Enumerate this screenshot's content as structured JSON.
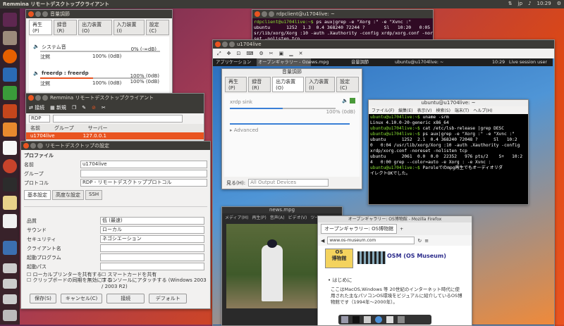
{
  "topbar": {
    "title": "Remmina リモートデスクトップクライアント",
    "kbd": "jp",
    "time": "10:29"
  },
  "launcher": {
    "icons": [
      "dash-icon",
      "files-icon",
      "firefox-icon",
      "writer-icon",
      "calc-icon",
      "impress-icon",
      "software-center-icon",
      "amazon-icon",
      "settings-icon",
      "terminal-icon",
      "text-editor-icon",
      "remmina-icon",
      "drive-icon",
      "drive-icon-2",
      "drive-icon-3",
      "trash-icon"
    ]
  },
  "volume_win": {
    "title": "音量調節",
    "tabs": [
      "再生(P)",
      "録音(R)",
      "出力装置(O)",
      "入力装置(I)",
      "設定(C)"
    ],
    "rows": [
      {
        "name": "システム音",
        "min": "沈黙",
        "mid": "100% (0dB)",
        "right": "0% (-∞dB)",
        "level": 0.0
      },
      {
        "name": "freerdp : freerdp",
        "min": "沈黙",
        "mid": "100% (0dB)",
        "right": "100% (0dB)",
        "right2": "100% (0dB)",
        "level": 0.5
      }
    ]
  },
  "remmina_win": {
    "title": "Remmina リモートデスクトップクライアント",
    "toolbar": [
      "接続",
      "新規"
    ],
    "protocol": "RDP",
    "cols": [
      "名前",
      "グループ",
      "サーバー"
    ],
    "rows": [
      {
        "name": "u1704live",
        "server": "127.0.0.1"
      }
    ]
  },
  "pref_win": {
    "title": "リモートデスクトップの設定",
    "section": "プロファイル",
    "labels": {
      "name": "名前",
      "group": "グループ",
      "protocol": "プロトコル"
    },
    "values": {
      "name": "u1704live",
      "protocol": "RDP - リモートデスクトッププロトコル"
    },
    "tabs": [
      "基本設定",
      "高度な設定",
      "SSH"
    ],
    "fields": [
      {
        "label": "品質",
        "value": "低 (最速)"
      },
      {
        "label": "サウンド",
        "value": "ローカル"
      },
      {
        "label": "セキュリティ",
        "value": "ネゴシエーション"
      },
      {
        "label": "クライアント名",
        "value": ""
      },
      {
        "label": "起動プログラム",
        "value": ""
      },
      {
        "label": "起動パス",
        "value": ""
      }
    ],
    "checks": [
      "ローカルプリンターを共有する",
      "クリップボードの同期を無効にする",
      "スマートカードを共有",
      "コンソールにアタッチする (Windows 2003 / 2003 R2)"
    ],
    "buttons": [
      "保存(S)",
      "キャンセル(C)",
      "接続",
      "デフォルト"
    ]
  },
  "term_top": {
    "title": "rdpclient@u1704live: ~",
    "lines": [
      [
        "rdpclient@u1704live:~$ ",
        "ps aux|grep -e \"Xorg :\" -e \"Xvnc :\""
      ],
      [
        "",
        "ubuntu      1252  1.3  0.4 368240 72244 ?       Sl   10:20   0:05 /u"
      ],
      [
        "",
        "sr/lib/xorg/Xorg :10 -auth .Xauthority -config xrdp/xorg.conf -nore"
      ],
      [
        "",
        "set -nolisten tcp"
      ]
    ]
  },
  "rdp_win": {
    "title": "u1704live",
    "panel": {
      "apps": "アプリケーション",
      "task1": "オープンギャラリー - O...",
      "task2": "news.mpg",
      "task3": "音量調節",
      "task4": "ubuntu@u1704live: ~",
      "time": "10:29",
      "session": "Live session user"
    }
  },
  "inner_volume": {
    "title": "音量調節",
    "tabs": [
      "再生(P)",
      "録音(R)",
      "出力装置(O)",
      "入力装置(I)",
      "設定(C)"
    ],
    "row": "xrdp sink",
    "mid": "100% (0dB)",
    "level": 0.5,
    "advanced": "Advanced",
    "show_label": "見る(H):",
    "show_value": "All Output Devices"
  },
  "inner_term": {
    "title": "ubuntu@u1704live: ~",
    "menu": [
      "ファイル(F)",
      "編集(E)",
      "表示(V)",
      "検索(S)",
      "端末(T)",
      "ヘルプ(H)"
    ],
    "lines": [
      [
        "ubuntu@u1704live:~$ ",
        "uname -srm"
      ],
      [
        "",
        "Linux 4.10.0-20-generic x86_64"
      ],
      [
        "ubuntu@u1704live:~$ ",
        "cat /etc/lsb-release |grep DESC"
      ],
      [
        "ubuntu@u1704live:~$ ",
        "ps aux|grep -e \"Xorg :\" -e \"Xvnc :\""
      ],
      [
        "",
        "ubuntu      1252  2.1  0.4 368240 72048 ?      Sl   10:2"
      ],
      [
        "",
        "0   0:04 /usr/lib/xorg/Xorg :10 -auth .Xauthority -config"
      ],
      [
        "",
        "xrdp/xorg.conf -noreset -nolisten tcp"
      ],
      [
        "",
        "ubuntu      2061  0.0  0.0  22352   976 pts/2    S+   10:2"
      ],
      [
        "",
        "4   0:00 grep --color=auto -e Xorg : -e Xvnc :"
      ],
      [
        "ubuntu@u1704live:~$ ",
        "Paroleでのmpg再生でもオーディオリダ"
      ],
      [
        "",
        "イレクトOKでした。"
      ]
    ]
  },
  "video_win": {
    "title": "news.mpg",
    "menu": [
      "メディア(M)",
      "再生(P)",
      "音声(A)",
      "ビデオ(V)",
      "ツール"
    ]
  },
  "firefox_win": {
    "title": "オープンギャラリー: OS博物館 - Mozilla Firefox",
    "tab": "オープンギャラリー: OS博物館",
    "url": "www.os-museum.com",
    "logo_line1": "OS",
    "logo_line2": "博物館",
    "banner": "OSM (OS Museum)",
    "heading": "はじめに",
    "para": "ここはMacOS,Windows 等 20世紀のインターネット時代に使用された主なパソコンOS環境をビジュアルに紹介しているOS博物館です（1994年〜2000年）。"
  }
}
